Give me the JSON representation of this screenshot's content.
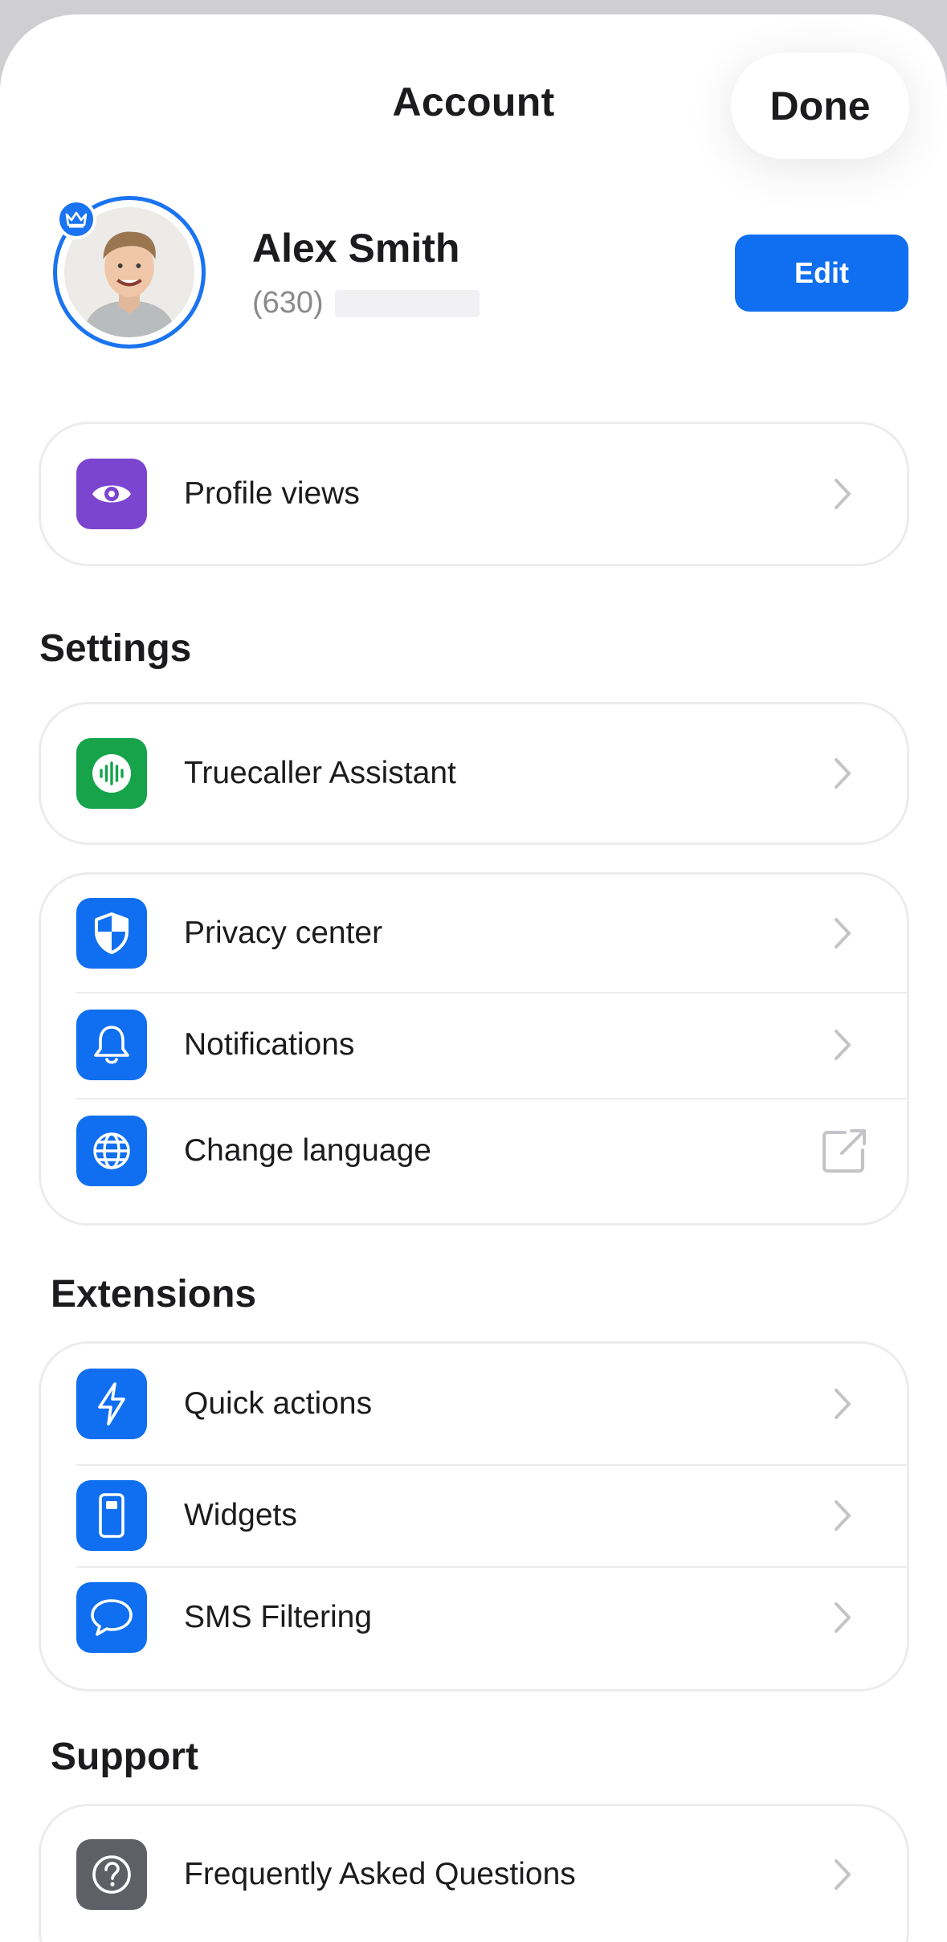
{
  "header": {
    "title": "Account",
    "done_label": "Done"
  },
  "profile": {
    "name": "Alex Smith",
    "phone_prefix": "(630)",
    "edit_label": "Edit"
  },
  "top_items": [
    {
      "label": "Profile views",
      "icon": "eye-icon",
      "color": "#7b45cf"
    }
  ],
  "sections": {
    "settings": "Settings",
    "extensions": "Extensions",
    "support": "Support"
  },
  "settings_assistant": [
    {
      "label": "Truecaller Assistant",
      "icon": "voice-wave-icon",
      "color": "#16a34a"
    }
  ],
  "settings_items": [
    {
      "label": "Privacy center",
      "icon": "shield-icon",
      "color": "#0f6ff0"
    },
    {
      "label": "Notifications",
      "icon": "bell-icon",
      "color": "#0f6ff0"
    },
    {
      "label": "Change language",
      "icon": "globe-icon",
      "color": "#0f6ff0"
    }
  ],
  "extension_items": [
    {
      "label": "Quick actions",
      "icon": "lightning-icon",
      "color": "#0f6ff0"
    },
    {
      "label": "Widgets",
      "icon": "phone-widget-icon",
      "color": "#0f6ff0"
    },
    {
      "label": "SMS Filtering",
      "icon": "chat-bubble-icon",
      "color": "#0f6ff0"
    }
  ],
  "support_items": [
    {
      "label": "Frequently Asked Questions",
      "icon": "question-icon",
      "color": "#5f6066"
    }
  ]
}
